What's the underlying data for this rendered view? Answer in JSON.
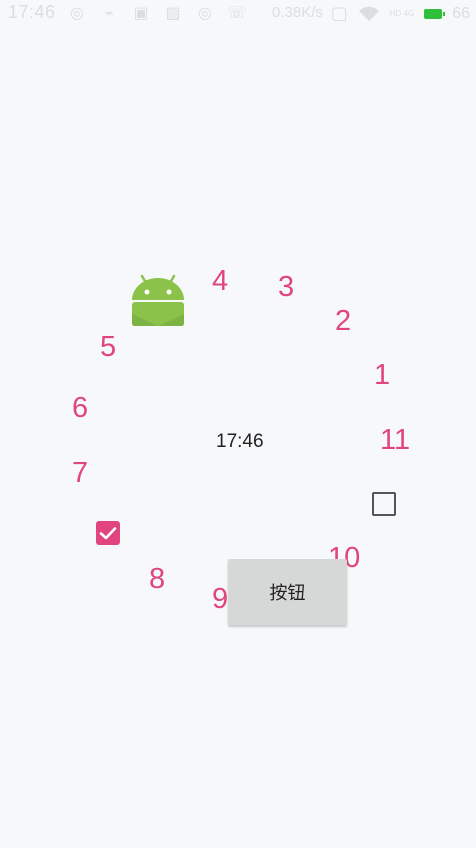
{
  "status_bar": {
    "time": "17:46",
    "speed": "0.38K/s",
    "network_label": "HD 4G",
    "battery": "66",
    "icons": [
      "weibo-icon",
      "usb-icon",
      "notification-icon",
      "gallery-icon",
      "weibo-icon-2",
      "phone-icon"
    ],
    "battery_color": "#2fbf3b"
  },
  "clock": {
    "numbers": {
      "n1": "1",
      "n2": "2",
      "n3": "3",
      "n4": "4",
      "n5": "5",
      "n6": "6",
      "n7": "7",
      "n8": "8",
      "n9": "9",
      "n10": "10",
      "n11": "11"
    },
    "center_time": "17:46",
    "number_color": "#e0457f"
  },
  "widgets": {
    "button_label": "按钮",
    "checkbox_checked": true,
    "checkbox_unchecked": false,
    "android_logo": "android-robot-icon",
    "accent": "#e0457f"
  }
}
